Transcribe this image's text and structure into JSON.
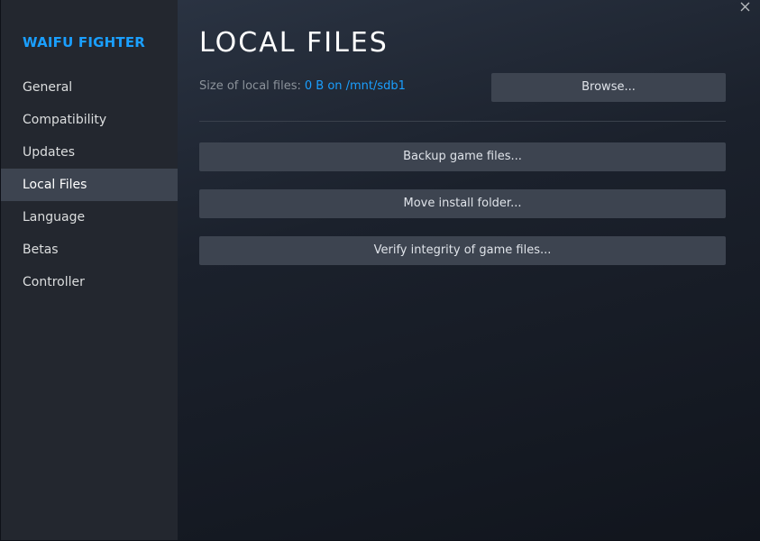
{
  "sidebar": {
    "game_title": "WAIFU FIGHTER",
    "items": [
      {
        "label": "General",
        "active": false
      },
      {
        "label": "Compatibility",
        "active": false
      },
      {
        "label": "Updates",
        "active": false
      },
      {
        "label": "Local Files",
        "active": true
      },
      {
        "label": "Language",
        "active": false
      },
      {
        "label": "Betas",
        "active": false
      },
      {
        "label": "Controller",
        "active": false
      }
    ]
  },
  "main": {
    "title": "LOCAL FILES",
    "size_label": "Size of local files:",
    "size_value": "0 B on /mnt/sdb1",
    "browse_label": "Browse...",
    "backup_label": "Backup game files...",
    "move_label": "Move install folder...",
    "verify_label": "Verify integrity of game files..."
  },
  "icons": {
    "close": "close-icon"
  },
  "colors": {
    "accent": "#1a9fff",
    "sidebar_bg": "#23272f",
    "active_item_bg": "#3d4450",
    "button_bg": "#3d4450"
  }
}
